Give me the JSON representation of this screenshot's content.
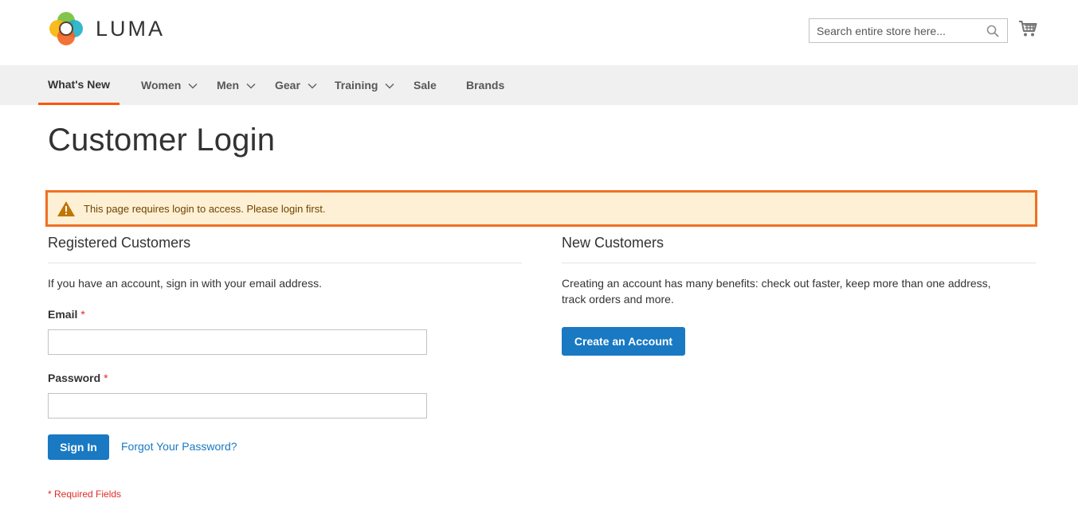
{
  "header": {
    "logo_text": "LUMA",
    "search_placeholder": "Search entire store here..."
  },
  "nav": {
    "items": [
      {
        "label": "What's New",
        "has_dropdown": false,
        "active": true
      },
      {
        "label": "Women",
        "has_dropdown": true
      },
      {
        "label": "Men",
        "has_dropdown": true
      },
      {
        "label": "Gear",
        "has_dropdown": true
      },
      {
        "label": "Training",
        "has_dropdown": true
      },
      {
        "label": "Sale",
        "has_dropdown": false
      },
      {
        "label": "Brands",
        "has_dropdown": false
      }
    ]
  },
  "page_title": "Customer Login",
  "notice": {
    "text": "This page requires login to access. Please login first.",
    "icon": "warning-icon"
  },
  "registered": {
    "title": "Registered Customers",
    "intro": "If you have an account, sign in with your email address.",
    "email_label": "Email",
    "password_label": "Password",
    "required_mark": "*",
    "email_value": "",
    "password_value": "",
    "sign_in": "Sign In",
    "forgot": "Forgot Your Password?",
    "required_note": "* Required Fields"
  },
  "new_customers": {
    "title": "New Customers",
    "intro_line1": "Creating an account has many benefits: check out faster, keep more than one address,",
    "intro_line2": "track orders and more.",
    "create_account": "Create an Account"
  },
  "colors": {
    "accent": "#1979c3",
    "nav_active": "#ff5501",
    "notice_border": "#f07022",
    "notice_bg": "#fdf0d5",
    "required": "#e02b27"
  }
}
